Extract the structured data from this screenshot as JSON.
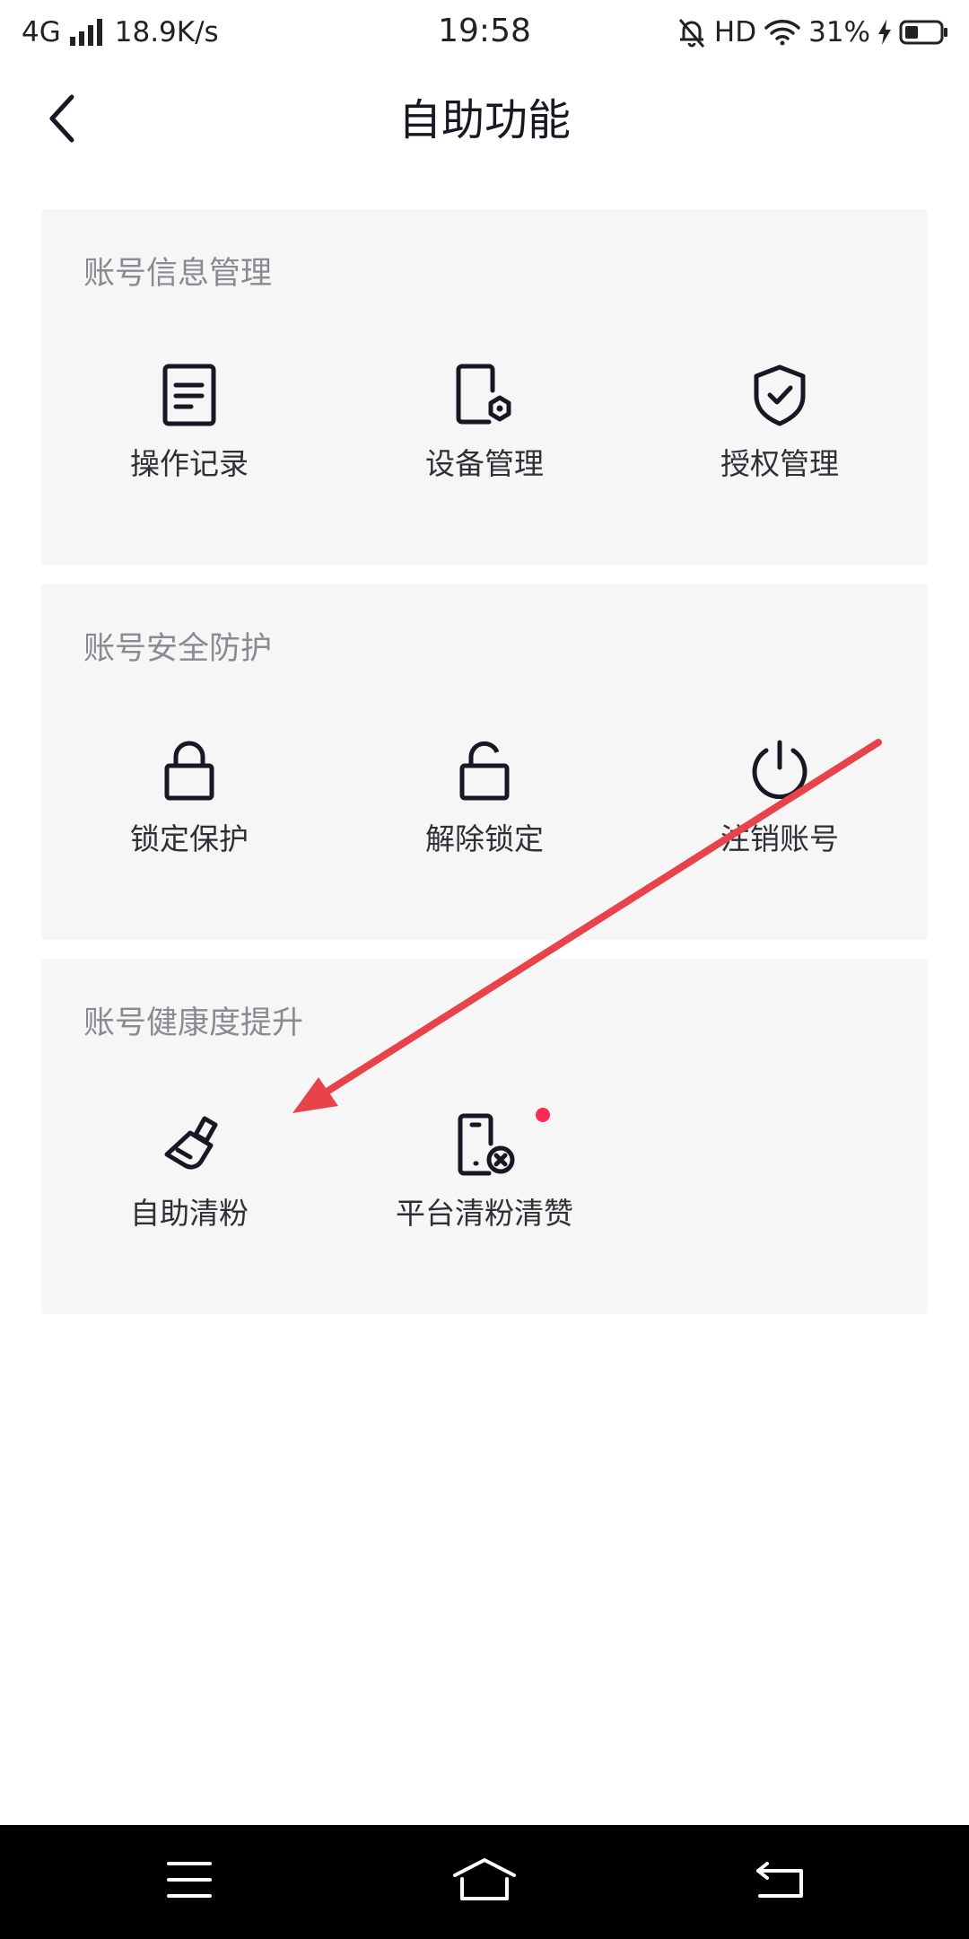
{
  "status_bar": {
    "network": "4G",
    "speed": "18.9K/s",
    "time": "19:58",
    "hd": "HD",
    "battery": "31%",
    "icons": [
      "signal-icon",
      "mute-bell-icon",
      "wifi-icon",
      "charging-icon",
      "battery-icon"
    ]
  },
  "header": {
    "title": "自助功能",
    "back_icon": "chevron-left-icon"
  },
  "sections": [
    {
      "title": "账号信息管理",
      "items": [
        {
          "label": "操作记录",
          "icon": "document-icon"
        },
        {
          "label": "设备管理",
          "icon": "device-settings-icon"
        },
        {
          "label": "授权管理",
          "icon": "shield-check-icon"
        }
      ]
    },
    {
      "title": "账号安全防护",
      "items": [
        {
          "label": "锁定保护",
          "icon": "lock-icon"
        },
        {
          "label": "解除锁定",
          "icon": "unlock-icon"
        },
        {
          "label": "注销账号",
          "icon": "power-icon"
        }
      ]
    },
    {
      "title": "账号健康度提升",
      "items": [
        {
          "label": "自助清粉",
          "icon": "brush-icon"
        },
        {
          "label": "平台清粉清赞",
          "icon": "phone-remove-icon",
          "badge": "red-dot"
        }
      ]
    }
  ],
  "nav_bar": {
    "icons": [
      "menu-icon",
      "home-icon",
      "back-return-icon"
    ]
  },
  "colors": {
    "card_bg": "#f7f6f7",
    "section_title": "#8a8b91",
    "label": "#2f3036",
    "badge": "#fe2c55",
    "annotation": "#e8434a",
    "nav_bg": "#000000"
  }
}
